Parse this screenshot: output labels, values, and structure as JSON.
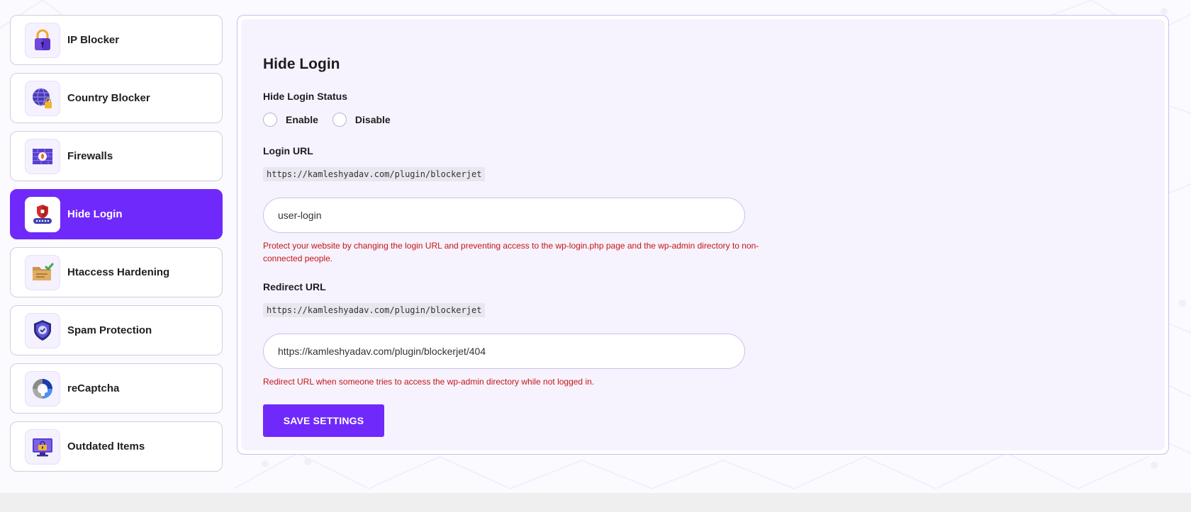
{
  "sidebar": {
    "items": [
      {
        "label": "IP Blocker",
        "icon": "padlock-icon"
      },
      {
        "label": "Country Blocker",
        "icon": "globe-lock-icon"
      },
      {
        "label": "Firewalls",
        "icon": "firewall-icon"
      },
      {
        "label": "Hide Login",
        "icon": "shield-password-icon",
        "active": true
      },
      {
        "label": "Htaccess Hardening",
        "icon": "folder-check-icon"
      },
      {
        "label": "Spam Protection",
        "icon": "shield-check-icon"
      },
      {
        "label": "reCaptcha",
        "icon": "recaptcha-icon"
      },
      {
        "label": "Outdated Items",
        "icon": "monitor-lock-icon"
      }
    ]
  },
  "main": {
    "title": "Hide Login",
    "status": {
      "label": "Hide Login Status",
      "options": [
        "Enable",
        "Disable"
      ],
      "selected": null
    },
    "login_url": {
      "label": "Login URL",
      "base": "https://kamleshyadav.com/plugin/blockerjet",
      "value": "user-login",
      "help": "Protect your website by changing the login URL and preventing access to the wp-login.php page and the wp-admin directory to non-connected people."
    },
    "redirect_url": {
      "label": "Redirect URL",
      "base": "https://kamleshyadav.com/plugin/blockerjet",
      "value": "https://kamleshyadav.com/plugin/blockerjet/404",
      "help": "Redirect URL when someone tries to access the wp-admin directory while not logged in."
    },
    "save_label": "SAVE SETTINGS"
  },
  "colors": {
    "accent": "#7029fb",
    "error_text": "#c41515",
    "panel_bg": "#f6f3fe",
    "panel_border": "#cbbdf6"
  }
}
